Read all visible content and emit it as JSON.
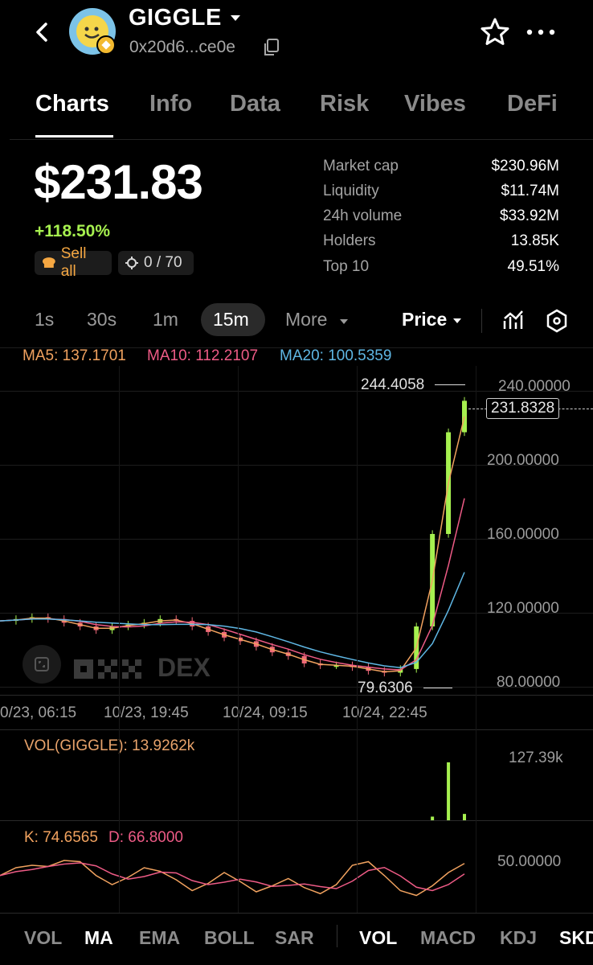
{
  "header": {
    "token_name": "GIGGLE",
    "address": "0x20d6...ce0e"
  },
  "tabs": [
    "Charts",
    "Info",
    "Data",
    "Risk",
    "Vibes",
    "DeFi"
  ],
  "price": {
    "value": "$231.83",
    "change": "+118.50%",
    "sell_label": "Sell all",
    "position_count": "0 / 70"
  },
  "stats": [
    {
      "label": "Market cap",
      "value": "$230.96M"
    },
    {
      "label": "Liquidity",
      "value": "$11.74M"
    },
    {
      "label": "24h volume",
      "value": "$33.92M"
    },
    {
      "label": "Holders",
      "value": "13.85K"
    },
    {
      "label": "Top 10",
      "value": "49.51%"
    }
  ],
  "intervals": [
    "1s",
    "30s",
    "1m",
    "15m",
    "More"
  ],
  "active_interval": "15m",
  "price_selector": "Price",
  "indicators": {
    "ma5": "MA5: 137.1701",
    "ma10": "MA10: 112.2107",
    "ma20": "MA20: 100.5359"
  },
  "colors": {
    "ma5": "#f1a25f",
    "ma10": "#ee5b86",
    "ma20": "#5fb7e4",
    "up": "#a6f04f",
    "down": "#f06a78"
  },
  "chart_data": {
    "type": "line",
    "y_ticks": [
      "240.00000",
      "200.00000",
      "160.00000",
      "120.00000",
      "80.00000"
    ],
    "ylim": [
      80,
      240
    ],
    "x_ticks": [
      "0/23, 06:15",
      "10/23, 19:45",
      "10/24, 09:15",
      "10/24, 22:45"
    ],
    "high_label": "244.4058",
    "low_label": "79.6306",
    "current_label": "231.8328",
    "series": [
      {
        "values": [
          113,
          114,
          115,
          114,
          112,
          110,
          108,
          110,
          111,
          112,
          114,
          113,
          110,
          107,
          104,
          102,
          99,
          96,
          94,
          90,
          89,
          89,
          88,
          86,
          85,
          87,
          110,
          160,
          215,
          232
        ]
      }
    ]
  },
  "volume": {
    "title": "VOL(GIGGLE): 13.9262k",
    "max_label": "127.39k",
    "values": [
      0,
      0,
      0,
      0,
      0,
      0,
      0,
      0,
      0,
      0,
      0,
      0,
      0,
      0,
      0,
      0,
      0,
      0,
      0,
      0,
      0,
      0,
      0,
      0,
      0,
      0,
      0,
      8,
      127.39,
      13.93
    ]
  },
  "kdj": {
    "k_label": "K: 74.6565",
    "d_label": "D: 66.8000",
    "tick": "50.00000",
    "k_values": [
      55,
      68,
      72,
      70,
      80,
      78,
      55,
      40,
      52,
      68,
      62,
      48,
      30,
      42,
      60,
      45,
      28,
      38,
      50,
      35,
      25,
      40,
      72,
      78,
      55,
      30,
      22,
      38,
      60,
      75
    ]
  },
  "bottom_tabs": [
    "VOL",
    "MA",
    "EMA",
    "BOLL",
    "SAR",
    "VOL",
    "MACD",
    "KDJ",
    "SKD"
  ],
  "watermark": "DEX"
}
